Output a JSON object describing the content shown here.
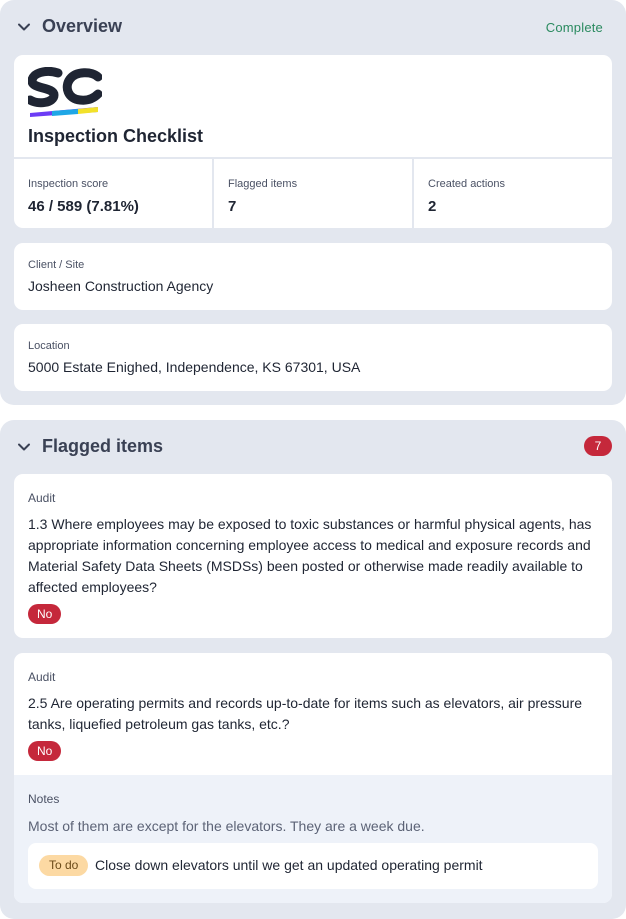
{
  "overview": {
    "title": "Overview",
    "status": "Complete",
    "template_title": "Inspection Checklist",
    "stats": [
      {
        "label": "Inspection score",
        "value": "46 / 589 (7.81%)"
      },
      {
        "label": "Flagged items",
        "value": "7"
      },
      {
        "label": "Created actions",
        "value": "2"
      }
    ],
    "client_site": {
      "label": "Client / Site",
      "value": "Josheen Construction Agency"
    },
    "location": {
      "label": "Location",
      "value": "5000 Estate Enighed, Independence, KS 67301, USA"
    }
  },
  "flagged": {
    "title": "Flagged items",
    "count": "7",
    "items": [
      {
        "section": "Audit",
        "question": "1.3 Where employees may be exposed to toxic substances or harmful physical agents, has appropriate information concerning employee access to medical and exposure records and Material Safety Data Sheets (MSDSs) been posted or otherwise made readily available to affected employees?",
        "response": "No"
      },
      {
        "section": "Audit",
        "question": "2.5 Are operating permits and records up-to-date for items such as elevators, air pressure tanks, liquefied petroleum gas tanks, etc.?",
        "response": "No",
        "notes_label": "Notes",
        "notes": "Most of them are except for the elevators. They are a week due.",
        "action_status": "To do",
        "action_text": "Close down elevators until we get an updated operating permit"
      }
    ]
  },
  "colors": {
    "section_bg": "#e3e7ef",
    "complete_green": "#2a8a5f",
    "flag_red": "#c5283b",
    "todo_orange": "#fcd9a3"
  },
  "icons": {
    "collapse": "chevron-down-icon",
    "logo": "safetyculture-logo"
  }
}
